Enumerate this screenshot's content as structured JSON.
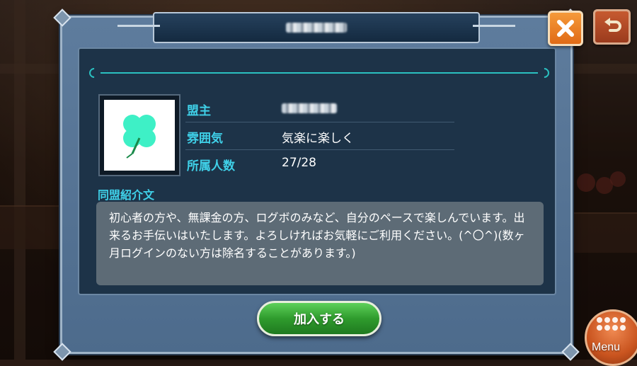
{
  "dialog": {
    "title": "■■■■",
    "leader_label": "盟主",
    "leader_value": "■■■■",
    "atmosphere_label": "雰囲気",
    "atmosphere_value": "気楽に楽しく",
    "members_label": "所属人数",
    "members_value": "27/28",
    "intro_title": "同盟紹介文",
    "intro_text": "初心者の方や、無課金の方、ログボのみなど、自分のペースで楽しんでいます。出来るお手伝いはいたします。よろしければお気軽にご利用ください。(^〇^)(数ヶ月ログインのない方は除名することがあります。)",
    "join_label": "加入する",
    "emblem_icon": "clover-icon"
  },
  "menu": {
    "label": "Menu"
  },
  "colors": {
    "accent_cyan": "#3fd0e8",
    "close_orange": "#e06a16",
    "join_green": "#2f9b2d",
    "panel_dark": "#1d3348",
    "intro_gray": "#5d6b76"
  }
}
